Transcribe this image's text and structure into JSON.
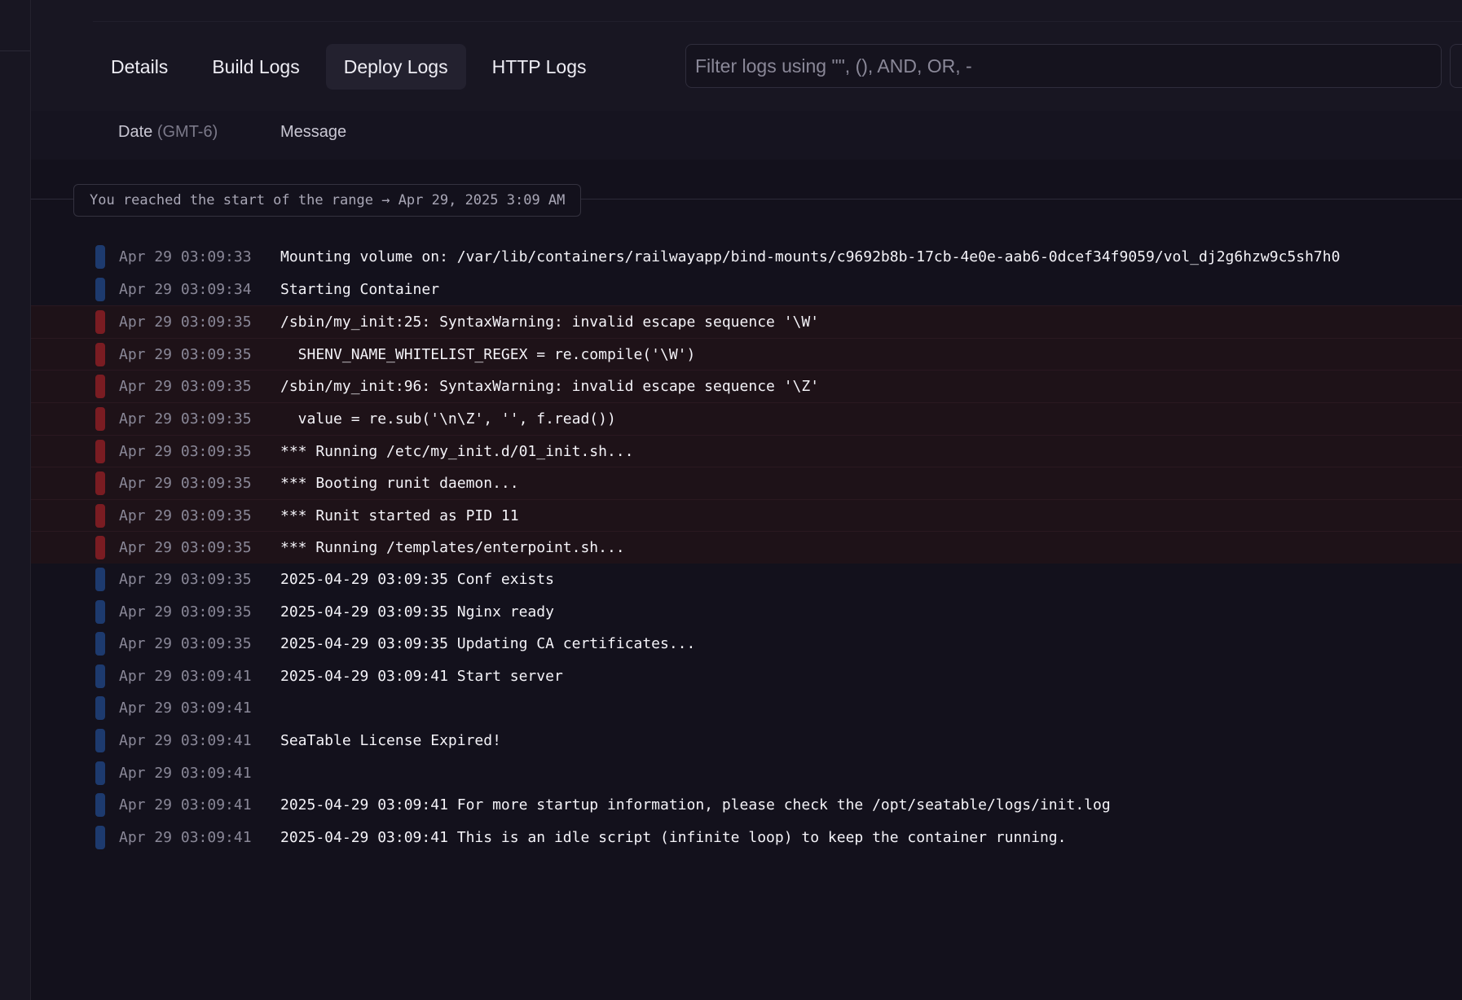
{
  "tabs": [
    {
      "label": "Details",
      "active": false
    },
    {
      "label": "Build Logs",
      "active": false
    },
    {
      "label": "Deploy Logs",
      "active": true
    },
    {
      "label": "HTTP Logs",
      "active": false
    }
  ],
  "filter": {
    "placeholder": "Filter logs using \"\", (), AND, OR, -"
  },
  "columns": {
    "date": "Date",
    "timezone": "(GMT-6)",
    "message": "Message"
  },
  "range_notice": "You reached the start of the range → Apr 29, 2025 3:09 AM",
  "colors": {
    "info_bar": "#1d3a6e",
    "error_bar": "#7a1c22",
    "error_row_bg": "#1e1218",
    "background": "#13111c"
  },
  "logs": [
    {
      "level": "info",
      "timestamp": "Apr 29 03:09:33",
      "message": "Mounting volume on: /var/lib/containers/railwayapp/bind-mounts/c9692b8b-17cb-4e0e-aab6-0dcef34f9059/vol_dj2g6hzw9c5sh7h0"
    },
    {
      "level": "info",
      "timestamp": "Apr 29 03:09:34",
      "message": "Starting Container"
    },
    {
      "level": "error",
      "timestamp": "Apr 29 03:09:35",
      "message": "/sbin/my_init:25: SyntaxWarning: invalid escape sequence '\\W'"
    },
    {
      "level": "error",
      "timestamp": "Apr 29 03:09:35",
      "message": "  SHENV_NAME_WHITELIST_REGEX = re.compile('\\W')"
    },
    {
      "level": "error",
      "timestamp": "Apr 29 03:09:35",
      "message": "/sbin/my_init:96: SyntaxWarning: invalid escape sequence '\\Z'"
    },
    {
      "level": "error",
      "timestamp": "Apr 29 03:09:35",
      "message": "  value = re.sub('\\n\\Z', '', f.read())"
    },
    {
      "level": "error",
      "timestamp": "Apr 29 03:09:35",
      "message": "*** Running /etc/my_init.d/01_init.sh..."
    },
    {
      "level": "error",
      "timestamp": "Apr 29 03:09:35",
      "message": "*** Booting runit daemon..."
    },
    {
      "level": "error",
      "timestamp": "Apr 29 03:09:35",
      "message": "*** Runit started as PID 11"
    },
    {
      "level": "error",
      "timestamp": "Apr 29 03:09:35",
      "message": "*** Running /templates/enterpoint.sh..."
    },
    {
      "level": "info",
      "timestamp": "Apr 29 03:09:35",
      "message": "2025-04-29 03:09:35 Conf exists"
    },
    {
      "level": "info",
      "timestamp": "Apr 29 03:09:35",
      "message": "2025-04-29 03:09:35 Nginx ready"
    },
    {
      "level": "info",
      "timestamp": "Apr 29 03:09:35",
      "message": "2025-04-29 03:09:35 Updating CA certificates..."
    },
    {
      "level": "info",
      "timestamp": "Apr 29 03:09:41",
      "message": "2025-04-29 03:09:41 Start server"
    },
    {
      "level": "info",
      "timestamp": "Apr 29 03:09:41",
      "message": ""
    },
    {
      "level": "info",
      "timestamp": "Apr 29 03:09:41",
      "message": "SeaTable License Expired!"
    },
    {
      "level": "info",
      "timestamp": "Apr 29 03:09:41",
      "message": ""
    },
    {
      "level": "info",
      "timestamp": "Apr 29 03:09:41",
      "message": "2025-04-29 03:09:41 For more startup information, please check the /opt/seatable/logs/init.log"
    },
    {
      "level": "info",
      "timestamp": "Apr 29 03:09:41",
      "message": "2025-04-29 03:09:41 This is an idle script (infinite loop) to keep the container running."
    }
  ]
}
